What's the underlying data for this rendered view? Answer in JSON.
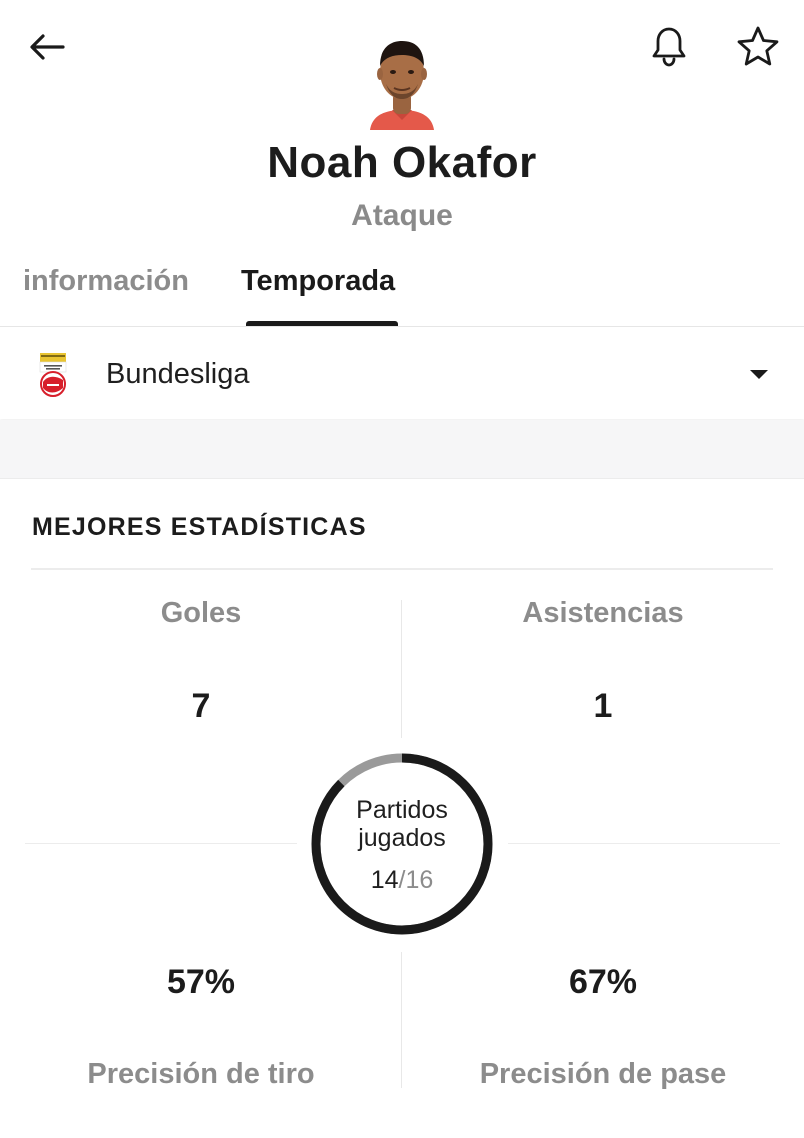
{
  "header": {
    "back_icon": "arrow-left-icon",
    "bell_icon": "bell-icon",
    "star_icon": "star-outline-icon"
  },
  "player": {
    "name": "Noah Okafor",
    "position": "Ataque"
  },
  "tabs": [
    {
      "label": "información",
      "active": false
    },
    {
      "label": "Temporada",
      "active": true
    }
  ],
  "league": {
    "name": "Bundesliga",
    "logo_icon": "league-crest-icon",
    "dropdown_icon": "caret-down-icon"
  },
  "stats": {
    "section_title": "MEJORES ESTADÍSTICAS",
    "goals": {
      "label": "Goles",
      "value": "7"
    },
    "assists": {
      "label": "Asistencias",
      "value": "1"
    },
    "matches": {
      "label": "Partidos jugados",
      "played": "14",
      "total": "16",
      "fraction_text": "/16",
      "fraction": 0.875
    },
    "shot_accuracy": {
      "label": "Precisión de tiro",
      "value": "57%"
    },
    "pass_accuracy": {
      "label": "Precisión de pase",
      "value": "67%"
    }
  },
  "colors": {
    "text": "#1c1c1c",
    "muted": "#8c8c8c",
    "ring_filled": "#1a1a1a",
    "ring_remaining": "#9a9a9a",
    "league_red": "#d71f2b",
    "league_gold": "#e9c431"
  }
}
